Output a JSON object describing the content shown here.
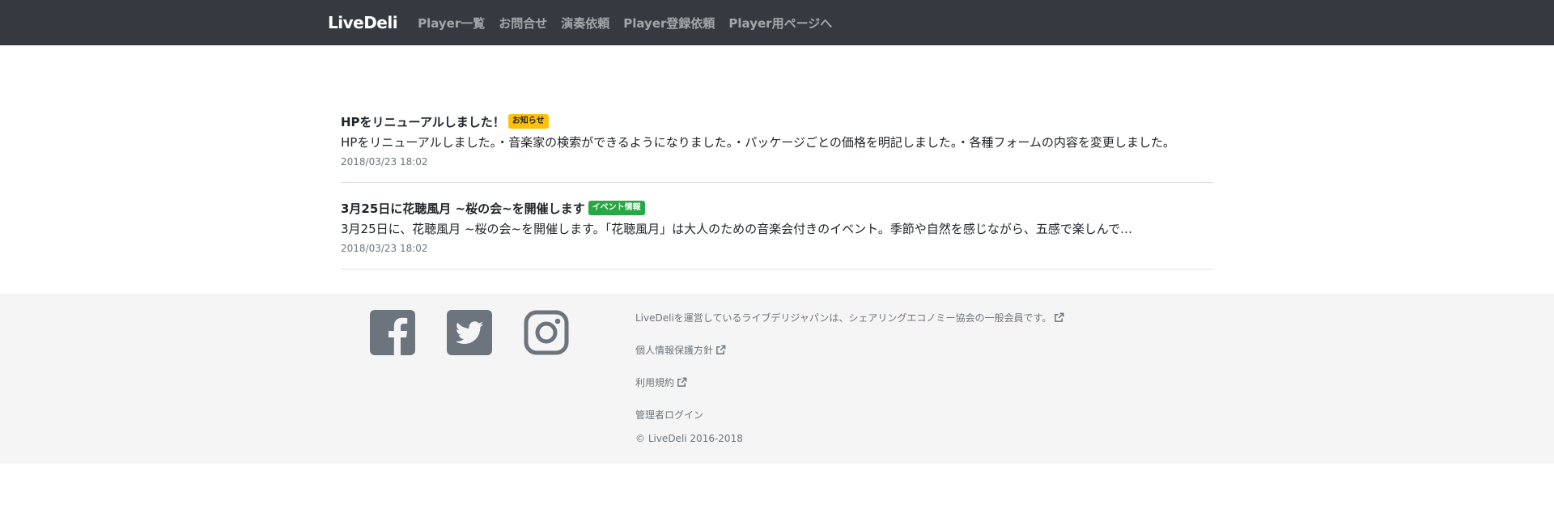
{
  "navbar": {
    "brand": "LiveDeli",
    "links": [
      "Player一覧",
      "お問合せ",
      "演奏依頼",
      "Player登録依頼",
      "Player用ページへ"
    ]
  },
  "news": [
    {
      "title": "HPをリニューアルしました！",
      "badge": "お知らせ",
      "summary": "HPをリニューアルしました。・音楽家の検索ができるようになりました。・パッケージごとの価格を明記しました。・各種フォームの内容を変更しました。",
      "date": "2018/03/23 18:02"
    },
    {
      "title": "3月25日に花聴風月 ~桜の会~を開催します",
      "badge": "イベント情報",
      "summary": "3月25日に、花聴風月 ~桜の会~を開催します。「花聴風月」は大人のための音楽会付きのイベント。季節や自然を感じながら、五感で楽しんで…",
      "date": "2018/03/23 18:02"
    }
  ],
  "footer": {
    "social": [
      "facebook-icon",
      "twitter-icon",
      "instagram-icon"
    ],
    "links": [
      "LiveDeliを運営しているライブデリジャパンは、シェアリングエコノミー協会の一般会員です。",
      "個人情報保護方針",
      "利用規約"
    ],
    "admin_login": "管理者ログイン",
    "copyright": "© LiveDeli 2016-2018"
  },
  "colors": {
    "navbar_bg": "#343a40",
    "badge_warning": "#ffc107",
    "badge_success": "#28a745",
    "footer_bg": "#f5f5f5",
    "icon_gray": "#6c757d"
  }
}
